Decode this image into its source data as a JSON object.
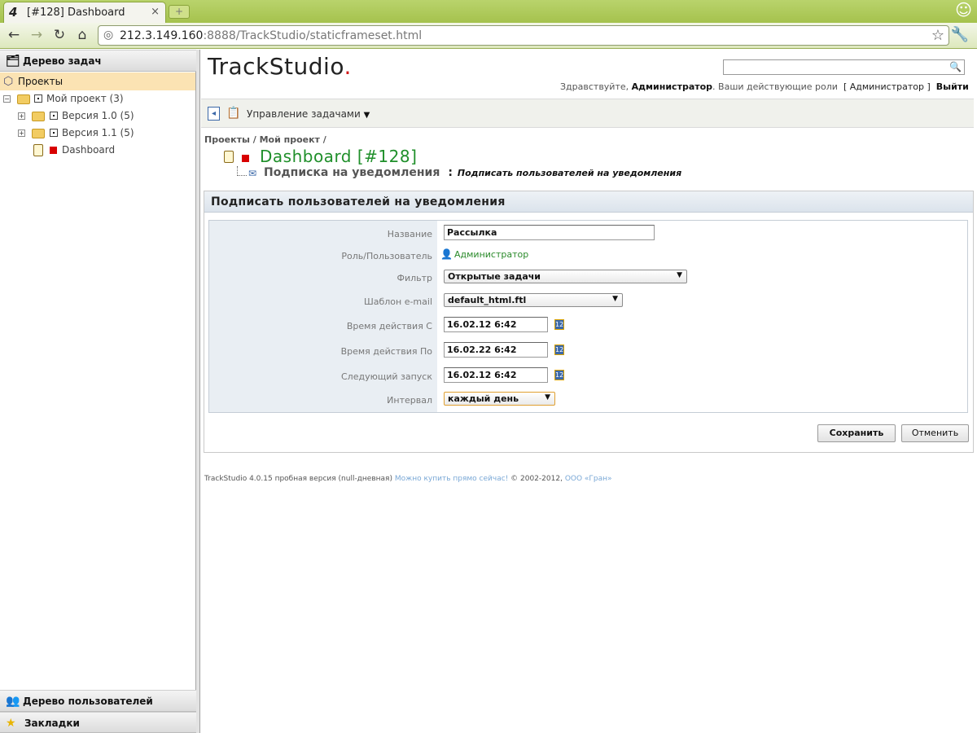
{
  "browser": {
    "tab_icon": "4",
    "tab_title": "[#128] Dashboard",
    "tab_close": "×",
    "new_tab": "+",
    "url_host": "212.3.149.160",
    "url_rest": ":8888/TrackStudio/staticframeset.html"
  },
  "sidebar": {
    "task_tree_header": "Дерево задач",
    "tree": {
      "projects": "Проекты",
      "my_project": "Мой проект (3)",
      "version_10": "Версия 1.0 (5)",
      "version_11": "Версия 1.1 (5)",
      "dashboard": "Dashboard"
    },
    "user_tree_header": "Дерево пользователей",
    "bookmarks_header": "Закладки"
  },
  "header": {
    "logo_text": "TrackStudio",
    "logo_dot": ".",
    "search_placeholder": "",
    "greeting_prefix": "Здравствуйте,",
    "greeting_user": "Администратор",
    "greeting_roles_prefix": ". Ваши действующие роли",
    "greeting_role": "[ Администратор ]",
    "logout": "Выйти"
  },
  "actionbar": {
    "tasks_menu": "Управление задачами"
  },
  "breadcrumb": "Проекты / Мой проект /",
  "task": {
    "title": "Dashboard [#128]",
    "subtitle": "Подписка на уведомления",
    "subtitle_sep": ":",
    "subtitle_current": "Подписать пользователей на уведомления"
  },
  "form": {
    "header": "Подписать пользователей на уведомления",
    "labels": {
      "name": "Название",
      "role_user": "Роль/Пользователь",
      "filter": "Фильтр",
      "email_template": "Шаблон e-mail",
      "time_from": "Время действия С",
      "time_to": "Время действия По",
      "next_run": "Следующий запуск",
      "interval": "Интервал"
    },
    "values": {
      "name": "Рассылка",
      "role_user": "Администратор",
      "filter": "Открытые задачи",
      "email_template": "default_html.ftl",
      "time_from": "16.02.12 6:42",
      "time_to": "16.02.22 6:42",
      "next_run": "16.02.12 6:42",
      "interval": "каждый день"
    },
    "save_button": "Сохранить",
    "cancel_button": "Отменить"
  },
  "footer": {
    "version": "TrackStudio 4.0.15 пробная версия (null-дневная)",
    "buy_link": "Можно купить прямо сейчас!",
    "copyright": "© 2002-2012,",
    "company_link": "ООО «Гран»"
  }
}
